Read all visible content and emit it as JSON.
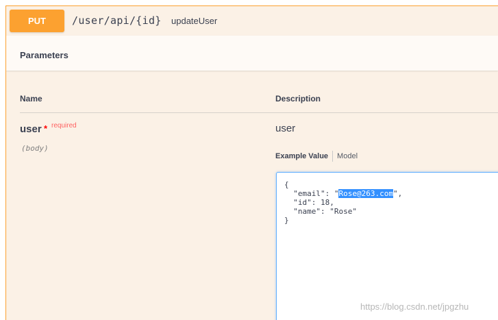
{
  "operation": {
    "method": "PUT",
    "path": "/user/api/{id}",
    "description": "updateUser",
    "method_color": "#fca130"
  },
  "parameters": {
    "title": "Parameters",
    "columns": {
      "name": "Name",
      "description": "Description"
    },
    "items": [
      {
        "name": "user",
        "required_mark": "*",
        "required_label": "required",
        "location": "(body)",
        "description": "user",
        "tabs": {
          "active": "Example Value",
          "other": "Model"
        },
        "example": {
          "open": "{",
          "email_key": "  \"email\": \"",
          "email_value": "Rose@263.com",
          "email_end": "\",",
          "id_line": "  \"id\": 18,",
          "name_line": "  \"name\": \"Rose\"",
          "close": "}"
        }
      }
    ]
  },
  "watermark": "https://blog.csdn.net/jpgzhu"
}
